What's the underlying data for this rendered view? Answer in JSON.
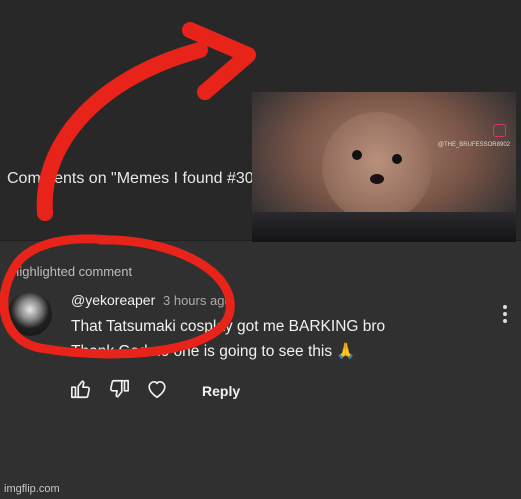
{
  "header": {
    "comments_title": "Comments on \"Memes I found #30"
  },
  "meme": {
    "watermark_handle": "@THE_BRUFESSOR8902",
    "watermark_icon": "instagram-icon"
  },
  "highlighted": {
    "label": "Highlighted comment"
  },
  "comment": {
    "username": "@yekoreaper",
    "timestamp": "3 hours ago",
    "line1": "That Tatsumaki cosplay got me BARKING bro",
    "line2": "Thank God no one is going to see this 🙏",
    "actions": {
      "like_icon": "thumbs-up-icon",
      "dislike_icon": "thumbs-down-icon",
      "heart_icon": "heart-icon",
      "reply_label": "Reply"
    }
  },
  "annotation": {
    "color": "#e8231a"
  },
  "footer": {
    "watermark": "imgflip.com"
  },
  "colors": {
    "background": "#303030",
    "top_background": "#282828",
    "text": "#f1f1f1",
    "muted_text": "#aaaaaa",
    "annotation_red": "#e8231a"
  }
}
